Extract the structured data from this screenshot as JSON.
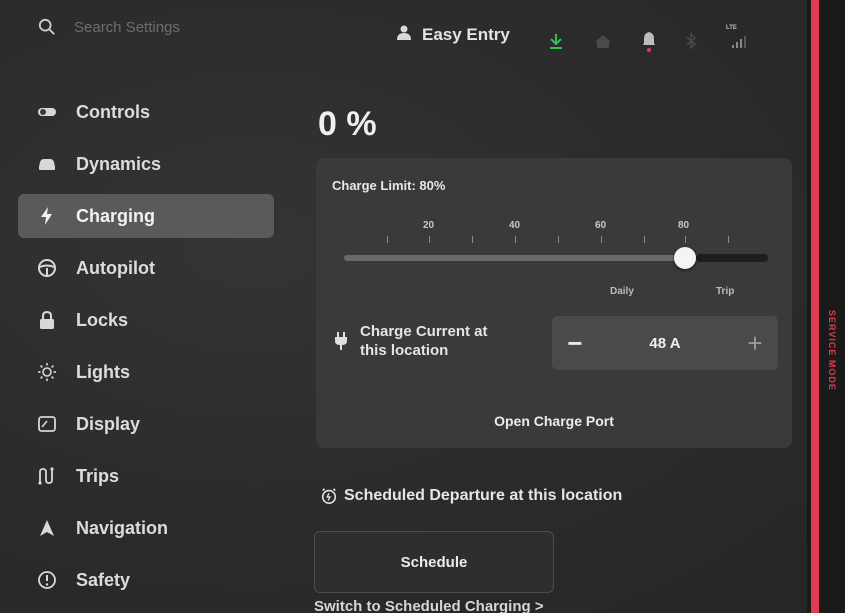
{
  "search": {
    "placeholder": "Search Settings"
  },
  "profile": {
    "name": "Easy Entry"
  },
  "status": {
    "network": "LTE"
  },
  "sidebar": {
    "items": [
      {
        "label": "Controls",
        "icon": "toggle-icon"
      },
      {
        "label": "Dynamics",
        "icon": "car-icon"
      },
      {
        "label": "Charging",
        "icon": "lightning-icon",
        "active": true
      },
      {
        "label": "Autopilot",
        "icon": "steering-wheel-icon"
      },
      {
        "label": "Locks",
        "icon": "lock-icon"
      },
      {
        "label": "Lights",
        "icon": "sun-icon"
      },
      {
        "label": "Display",
        "icon": "display-icon"
      },
      {
        "label": "Trips",
        "icon": "trips-icon"
      },
      {
        "label": "Navigation",
        "icon": "navigation-arrow-icon"
      },
      {
        "label": "Safety",
        "icon": "alert-circle-icon"
      }
    ]
  },
  "charging": {
    "battery_percent": "0 %",
    "charge_limit_label": "Charge Limit: 80%",
    "charge_limit_value": 80,
    "scale_labels": [
      "20",
      "40",
      "60",
      "80"
    ],
    "range_labels": {
      "daily": "Daily",
      "trip": "Trip"
    },
    "current_label_line1": "Charge Current at",
    "current_label_line2": "this location",
    "current_value": "48 A",
    "minus": "−",
    "plus": "+",
    "open_port": "Open Charge Port"
  },
  "schedule": {
    "title": "Scheduled Departure at this location",
    "button": "Schedule",
    "switch_link": "Switch to Scheduled Charging >"
  },
  "service": {
    "label": "SERVICE MODE",
    "color": "#e23a4e"
  }
}
